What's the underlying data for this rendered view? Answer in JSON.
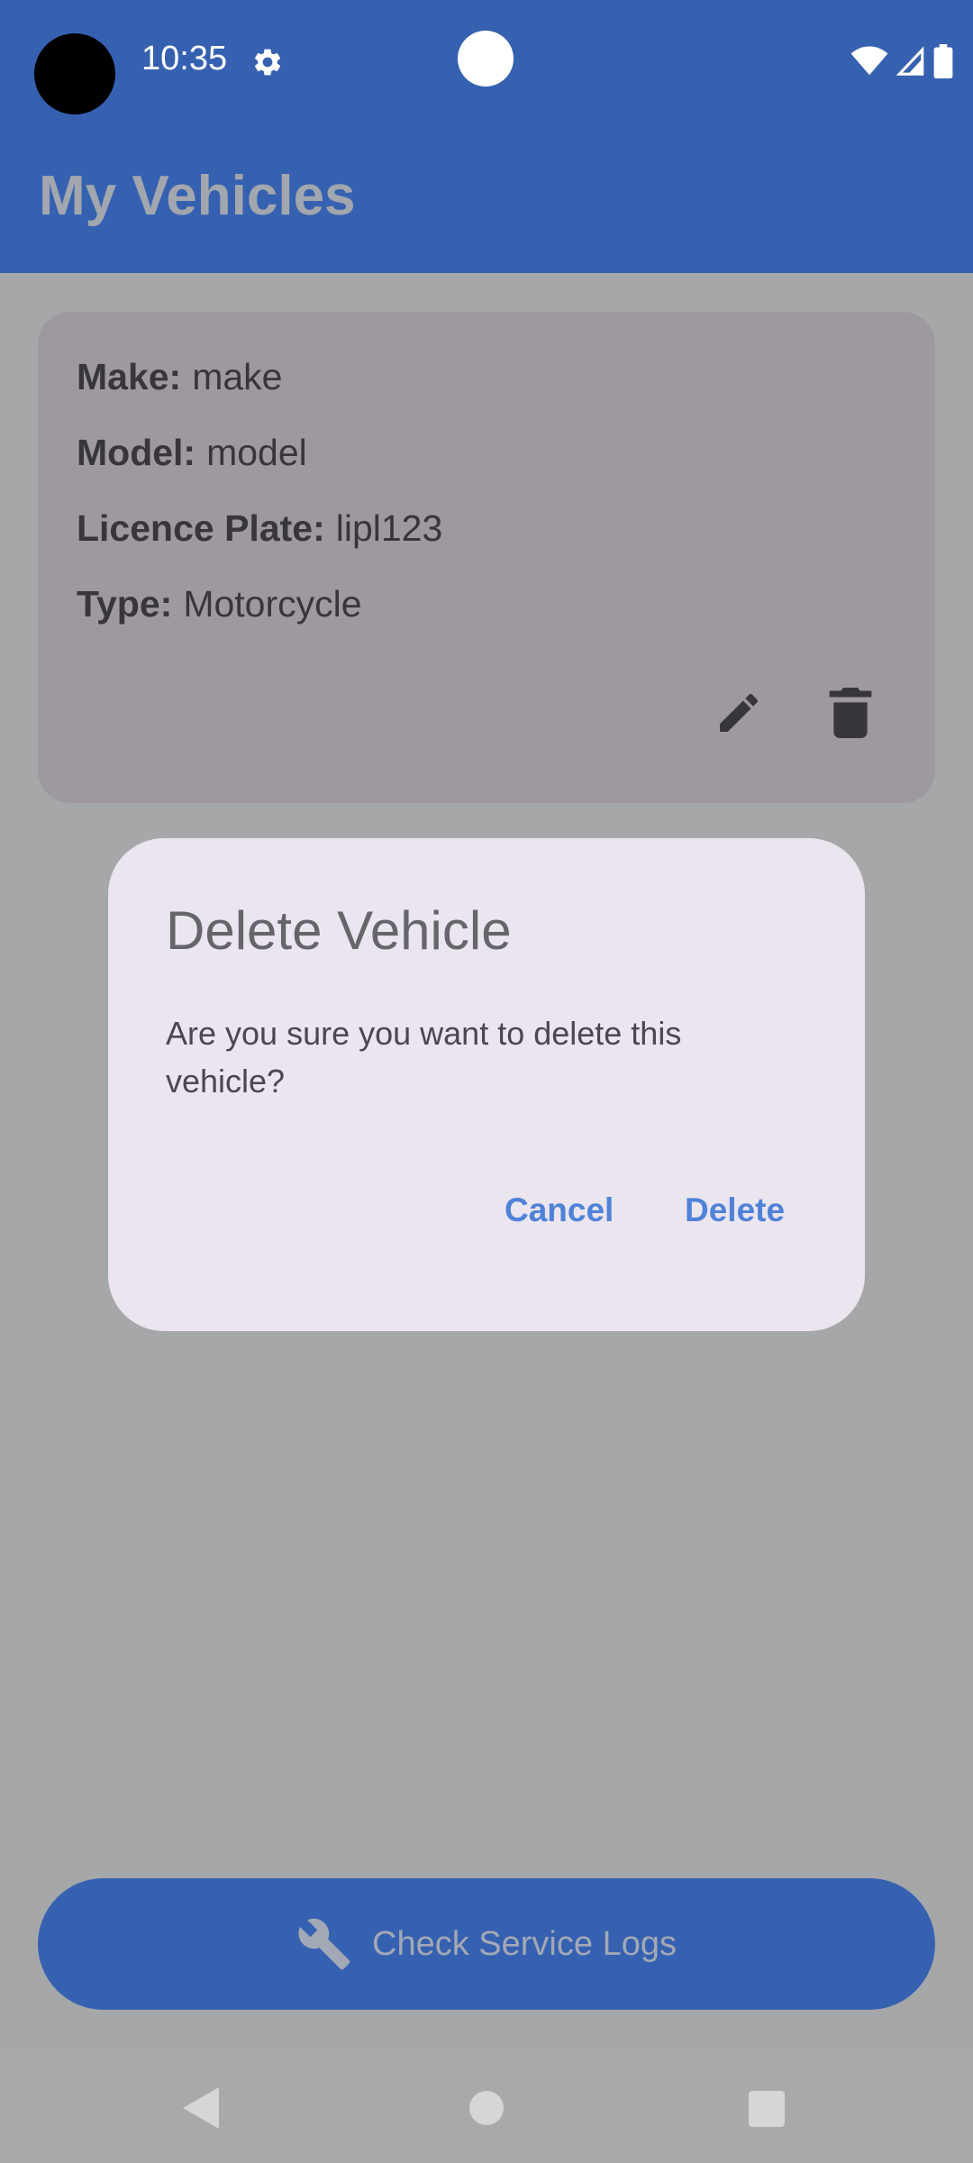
{
  "status_bar": {
    "time": "10:35"
  },
  "app_bar": {
    "title": "My Vehicles"
  },
  "vehicle_card": {
    "make_label": "Make:",
    "make_value": "make",
    "model_label": "Model:",
    "model_value": "model",
    "plate_label": "Licence Plate:",
    "plate_value": "lipl123",
    "type_label": "Type:",
    "type_value": "Motorcycle",
    "icons": [
      "pencil-icon",
      "trash-icon"
    ]
  },
  "dialog": {
    "title": "Delete Vehicle",
    "message": "Are you sure you want to delete this vehicle?",
    "cancel_label": "Cancel",
    "confirm_label": "Delete"
  },
  "bottom_action": {
    "label": "Check Service Logs",
    "icon": "wrench-icon"
  },
  "colors": {
    "primary": "#3661b0",
    "scrim_background": "#a6a7a9",
    "card": "#9d999f",
    "dialog": "#ebe5ef",
    "dialog_action_text": "#4f82d8"
  }
}
